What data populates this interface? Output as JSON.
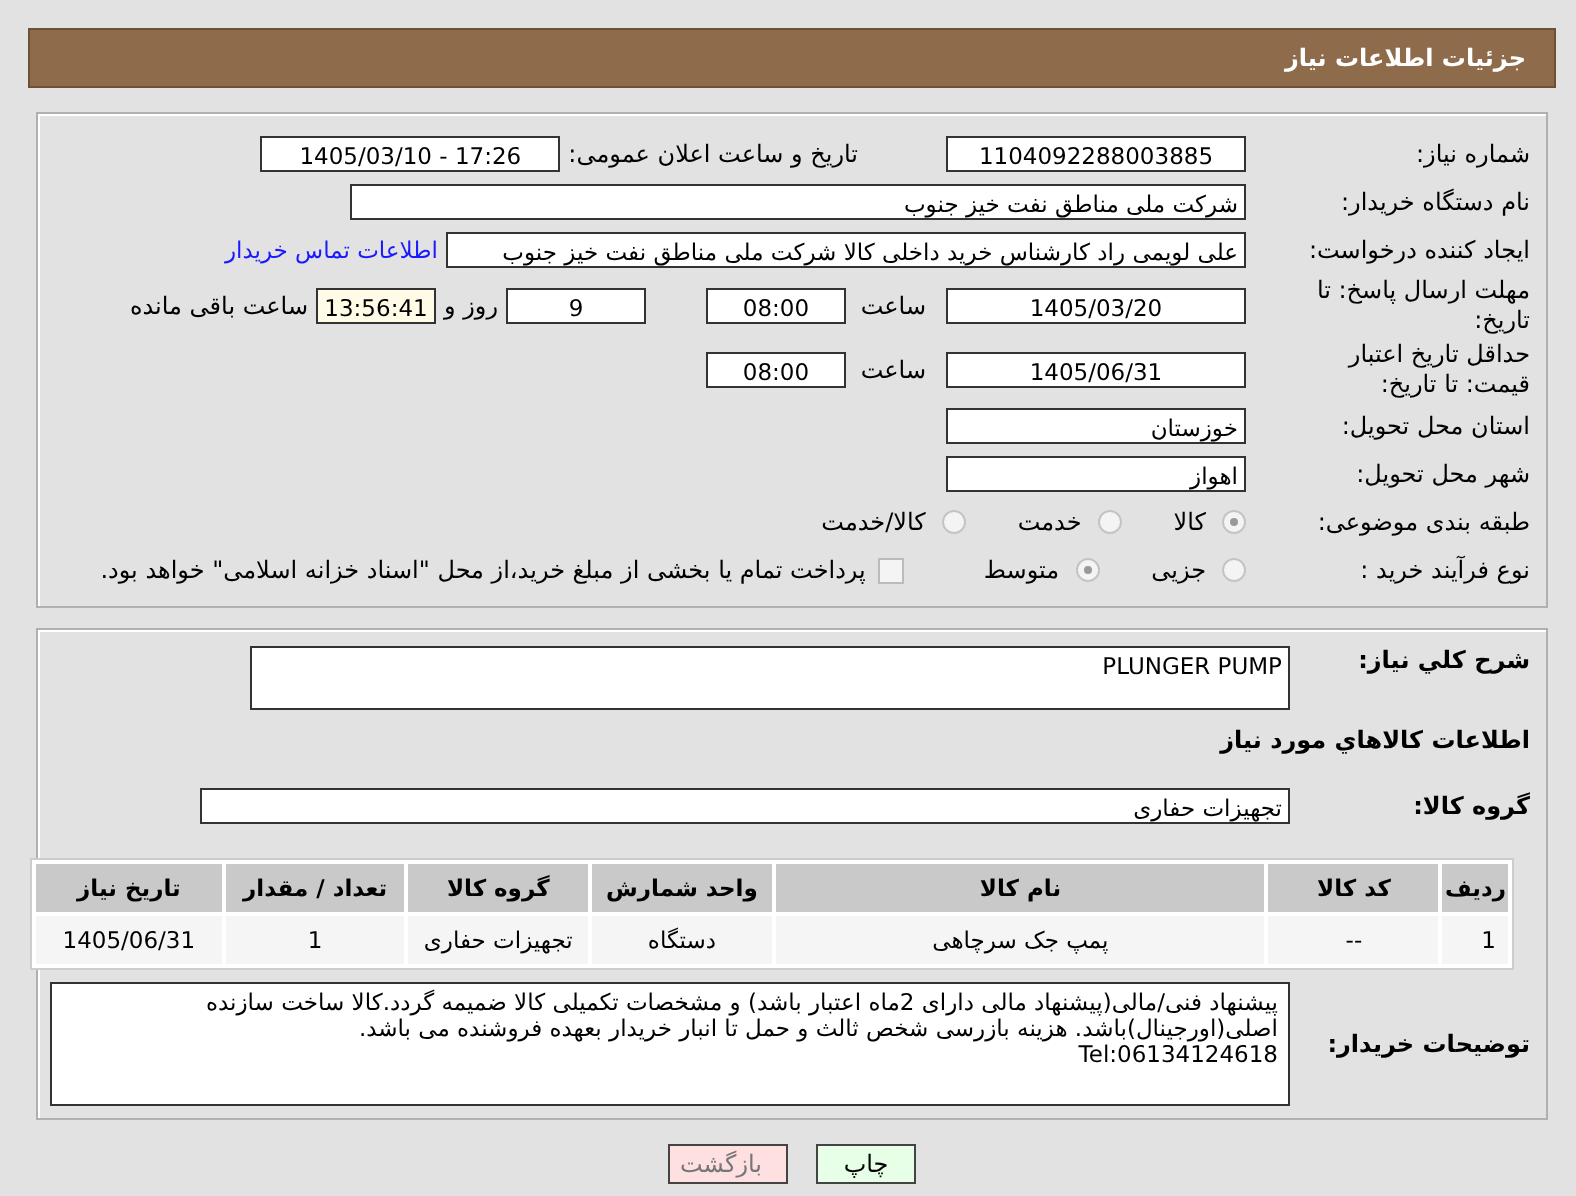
{
  "header": {
    "title": "جزئیات اطلاعات نیاز"
  },
  "details": {
    "need_number": {
      "label": "شماره نیاز:",
      "value": "1104092288003885"
    },
    "announce": {
      "label": "تاریخ و ساعت اعلان عمومی:",
      "value": "1405/03/10 - 17:26"
    },
    "buyer": {
      "label": "نام دستگاه خریدار:",
      "value": "شرکت ملی مناطق نفت خیز جنوب"
    },
    "creator": {
      "label": "ایجاد کننده درخواست:",
      "value": "علی  لویمی راد  کارشناس خرید داخلی کالا شرکت ملی مناطق نفت خیز جنوب",
      "link": "اطلاعات تماس خریدار"
    },
    "deadline": {
      "label": "مهلت ارسال پاسخ: تا تاریخ:",
      "date": "1405/03/20",
      "time_label": "ساعت",
      "time": "08:00",
      "days": "9",
      "days_label": "روز و",
      "remaining": "13:56:41",
      "remaining_label": "ساعت باقی مانده"
    },
    "validity": {
      "label": "حداقل تاریخ اعتبار قیمت: تا تاریخ:",
      "date": "1405/06/31",
      "time_label": "ساعت",
      "time": "08:00"
    },
    "province": {
      "label": "استان محل تحویل:",
      "value": "خوزستان"
    },
    "city": {
      "label": "شهر محل تحویل:",
      "value": "اهواز"
    },
    "category": {
      "label": "طبقه بندی موضوعی:",
      "options": [
        {
          "label": "کالا",
          "selected": true
        },
        {
          "label": "خدمت",
          "selected": false
        },
        {
          "label": "کالا/خدمت",
          "selected": false
        }
      ]
    },
    "process": {
      "label": "نوع فرآیند خرید :",
      "options": [
        {
          "label": "جزیی",
          "selected": false
        },
        {
          "label": "متوسط",
          "selected": true
        }
      ],
      "payment": {
        "checked": false,
        "text": "پرداخت تمام یا بخشی از مبلغ خرید،از محل \"اسناد خزانه اسلامی\" خواهد بود."
      }
    }
  },
  "goods": {
    "description": {
      "label": "شرح کلي نياز:",
      "value": "PLUNGER PUMP"
    },
    "section_title": "اطلاعات کالاهاي مورد نياز",
    "group": {
      "label": "گروه کالا:",
      "value": "تجهیزات حفاری"
    },
    "table": {
      "columns": [
        "ردیف",
        "کد کالا",
        "نام کالا",
        "واحد شمارش",
        "گروه کالا",
        "تعداد / مقدار",
        "تاریخ نیاز"
      ],
      "rows": [
        [
          "1",
          "--",
          "پمپ جک سرچاهی",
          "دستگاه",
          "تجهیزات حفاری",
          "1",
          "1405/06/31"
        ]
      ]
    },
    "notes": {
      "label": "توضیحات خریدار:",
      "value": "پیشنهاد فنی/مالی(پیشنهاد مالی دارای 2ماه اعتبار باشد) و مشخصات تکمیلی کالا ضمیمه گردد.کالا ساخت سازنده اصلی(اورجینال)باشد. هزینه بازرسی شخص ثالث و حمل تا انبار خریدار بعهده فروشنده می باشد.\nTel:06134124618"
    }
  },
  "buttons": [
    {
      "kind": "print",
      "label": "چاپ"
    },
    {
      "kind": "back",
      "label": "بازگشت"
    }
  ]
}
